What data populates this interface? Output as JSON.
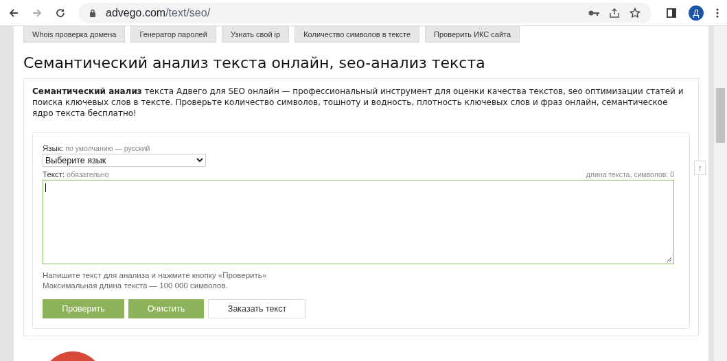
{
  "browser": {
    "url_host": "advego.com",
    "url_path": "/text/seo/",
    "profile_initial": "Д"
  },
  "tool_links": [
    {
      "label": "Whois проверка домена"
    },
    {
      "label": "Генератор паролей"
    },
    {
      "label": "Узнать свой ip"
    },
    {
      "label": "Количество символов в тексте"
    },
    {
      "label": "Проверить ИКС сайта"
    }
  ],
  "title": "Семантический анализ текста онлайн, seo-анализ текста",
  "intro": "**Семантический анализ** текста Адвего для SEO онлайн — профессиональный инструмент для оценки качества текстов, seo оптимизации статей и поиска ключевых слов в тексте. Проверьте количество символов, тошноту и водность, плотность ключевых слов и фраз онлайн, семантическое ядро текста бесплатно!",
  "form": {
    "language_label": "Язык:",
    "language_hint": "по умолчанию — русский",
    "language_value": "Выберите язык",
    "text_label": "Текст:",
    "text_hint": "обязательно",
    "length_counter": "длина текста, символов: 0",
    "help_lines": [
      "Напишите текст для анализа и нажмите кнопку «Проверить»",
      "Максимальная длина текста — 100 000 символов."
    ],
    "buttons": [
      {
        "label": "Проверить",
        "kind": "primary"
      },
      {
        "label": "Очистить",
        "kind": "primary"
      },
      {
        "label": "Заказать текст",
        "kind": "secondary"
      }
    ]
  },
  "scroll_top_button": "↑"
}
